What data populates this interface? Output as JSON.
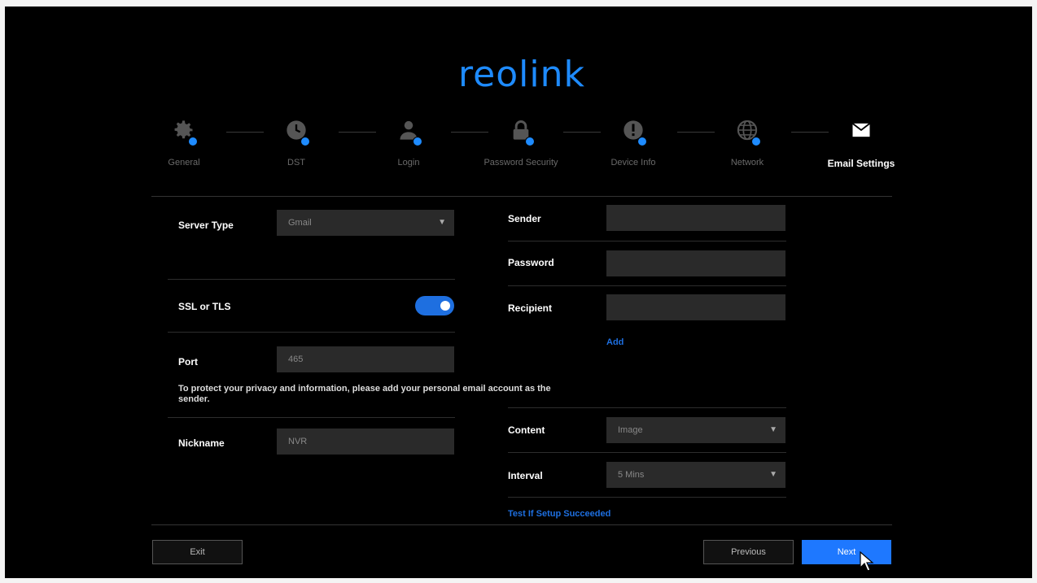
{
  "brand": {
    "logo_text": "reolink"
  },
  "steps": [
    {
      "label": "General",
      "icon": "gear-icon"
    },
    {
      "label": "DST",
      "icon": "clock-icon"
    },
    {
      "label": "Login",
      "icon": "user-icon"
    },
    {
      "label": "Password Security",
      "icon": "lock-icon"
    },
    {
      "label": "Device Info",
      "icon": "info-icon"
    },
    {
      "label": "Network",
      "icon": "globe-icon"
    },
    {
      "label": "Email Settings",
      "icon": "envelope-icon",
      "active": true
    }
  ],
  "left": {
    "server_type_label": "Server Type",
    "server_type_value": "Gmail",
    "ssl_label": "SSL or TLS",
    "ssl_enabled": true,
    "port_label": "Port",
    "port_value": "465",
    "privacy_note": "To protect your privacy and information, please add your personal email account as the sender.",
    "nickname_label": "Nickname",
    "nickname_value": "NVR"
  },
  "right": {
    "sender_label": "Sender",
    "sender_value": "",
    "password_label": "Password",
    "password_value": "",
    "recipient_label": "Recipient",
    "recipient_value": "",
    "add_label": "Add",
    "content_label": "Content",
    "content_value": "Image",
    "interval_label": "Interval",
    "interval_value": "5 Mins",
    "test_link": "Test If Setup Succeeded"
  },
  "footer": {
    "exit_label": "Exit",
    "previous_label": "Previous",
    "next_label": "Next"
  },
  "colors": {
    "accent": "#1e78ff",
    "background": "#000000",
    "field": "#2a2a2a"
  }
}
